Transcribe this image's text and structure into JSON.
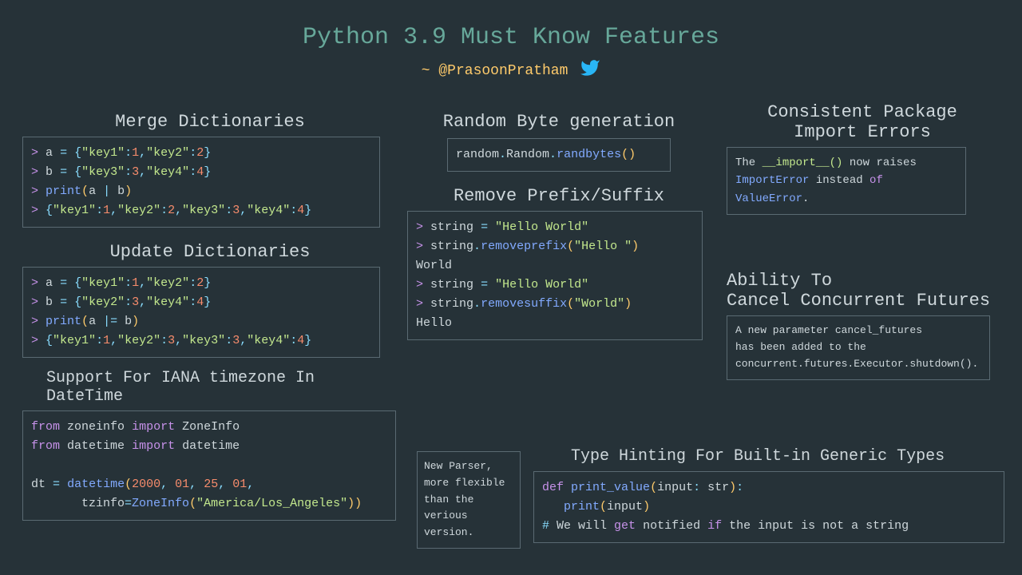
{
  "title": "Python 3.9 Must Know Features",
  "author_prefix": "~ ",
  "author_handle": "@PrasoonPratham",
  "sections": {
    "merge": {
      "title": "Merge Dictionaries",
      "lines": [
        "> a = {\"key1\":1,\"key2\":2}",
        "> b = {\"key3\":3,\"key4\":4}",
        "> print(a | b)",
        "> {\"key1\":1,\"key2\":2,\"key3\":3,\"key4\":4}"
      ]
    },
    "update": {
      "title": "Update Dictionaries",
      "lines": [
        "> a = {\"key1\":1,\"key2\":2}",
        "> b = {\"key2\":3,\"key4\":4}",
        "> print(a |= b)",
        "> {\"key1\":1,\"key2\":3,\"key3\":3,\"key4\":4}"
      ]
    },
    "iana": {
      "title": "Support For IANA timezone In DateTime",
      "lines": [
        "from zoneinfo import ZoneInfo",
        "from datetime import datetime",
        "",
        "dt = datetime(2000, 01, 25, 01,",
        "       tzinfo=ZoneInfo(\"America/Los_Angeles\"))"
      ]
    },
    "rand": {
      "title": "Random Byte generation",
      "code": "random.Random.randbytes()"
    },
    "prefix": {
      "title": "Remove Prefix/Suffix",
      "lines": [
        "> string = \"Hello World\"",
        "> string.removeprefix(\"Hello \")",
        "World",
        "> string = \"Hello World\"",
        "> string.removesuffix(\"World\")",
        "Hello"
      ]
    },
    "parser": {
      "text1": "New Parser,",
      "text2": "more flexible",
      "text3": "than the",
      "text4": "verious version."
    },
    "consistent": {
      "title1": "Consistent Package",
      "title2": "Import Errors",
      "text_pre": "The ",
      "text_code": "__import__()",
      "text_mid": " now raises ",
      "text_err1": "ImportError",
      "text_instead": " instead ",
      "text_of": "of",
      "text_sp": " ",
      "text_err2": "ValueError",
      "text_dot": "."
    },
    "cancel": {
      "title1": "Ability To",
      "title2": "Cancel Concurrent Futures",
      "text1": "A new parameter cancel_futures",
      "text2": "has been added to the",
      "text3": "concurrent.futures.Executor.shutdown()."
    },
    "typehint": {
      "title": "Type Hinting For Built-in Generic Types",
      "lines": [
        "def print_value(input: str):",
        "   print(input)",
        "# We will get notified if the input is not a string"
      ]
    }
  }
}
